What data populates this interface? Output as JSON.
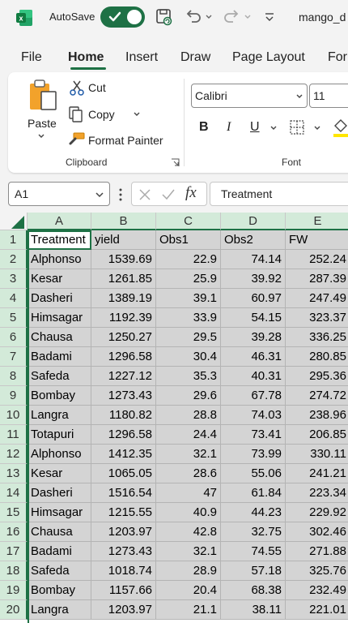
{
  "titlebar": {
    "app_icon": "excel-logo-icon",
    "autosave_label": "AutoSave",
    "autosave_state": "on",
    "filename": "mango_d"
  },
  "menu": [
    "File",
    "Home",
    "Insert",
    "Draw",
    "Page Layout",
    "For"
  ],
  "active_menu": "Home",
  "ribbon": {
    "paste": "Paste",
    "cut": "Cut",
    "copy": "Copy",
    "format_painter": "Format Painter",
    "clipboard_label": "Clipboard",
    "font_name": "Calibri",
    "font_size": "11",
    "bold": "B",
    "italic": "I",
    "underline": "U",
    "font_label": "Font"
  },
  "formula_bar": {
    "name_box": "A1",
    "fx": "fx",
    "formula": "Treatment"
  },
  "columns": [
    "A",
    "B",
    "C",
    "D",
    "E"
  ],
  "headers": [
    "Treatment",
    "yield",
    "Obs1",
    "Obs2",
    "FW"
  ],
  "rows": [
    [
      "Alphonso",
      "1539.69",
      "22.9",
      "74.14",
      "252.24"
    ],
    [
      "Kesar",
      "1261.85",
      "25.9",
      "39.92",
      "287.39"
    ],
    [
      "Dasheri",
      "1389.19",
      "39.1",
      "60.97",
      "247.49"
    ],
    [
      "Himsagar",
      "1192.39",
      "33.9",
      "54.15",
      "323.37"
    ],
    [
      "Chausa",
      "1250.27",
      "29.5",
      "39.28",
      "336.25"
    ],
    [
      "Badami",
      "1296.58",
      "30.4",
      "46.31",
      "280.85"
    ],
    [
      "Safeda",
      "1227.12",
      "35.3",
      "40.31",
      "295.36"
    ],
    [
      "Bombay",
      "1273.43",
      "29.6",
      "67.78",
      "274.72"
    ],
    [
      "Langra",
      "1180.82",
      "28.8",
      "74.03",
      "238.96"
    ],
    [
      "Totapuri",
      "1296.58",
      "24.4",
      "73.41",
      "206.85"
    ],
    [
      "Alphonso",
      "1412.35",
      "32.1",
      "73.99",
      "330.11"
    ],
    [
      "Kesar",
      "1065.05",
      "28.6",
      "55.06",
      "241.21"
    ],
    [
      "Dasheri",
      "1516.54",
      "47",
      "61.84",
      "223.34"
    ],
    [
      "Himsagar",
      "1215.55",
      "40.9",
      "44.23",
      "229.92"
    ],
    [
      "Chausa",
      "1203.97",
      "42.8",
      "32.75",
      "302.46"
    ],
    [
      "Badami",
      "1273.43",
      "32.1",
      "74.55",
      "271.88"
    ],
    [
      "Safeda",
      "1018.74",
      "28.9",
      "57.18",
      "325.76"
    ],
    [
      "Bombay",
      "1157.66",
      "20.4",
      "68.38",
      "232.49"
    ],
    [
      "Langra",
      "1203.97",
      "21.1",
      "38.11",
      "221.01"
    ]
  ],
  "row_numbers": [
    "1",
    "2",
    "3",
    "4",
    "5",
    "6",
    "7",
    "8",
    "9",
    "10",
    "11",
    "12",
    "13",
    "14",
    "15",
    "16",
    "17",
    "18",
    "19",
    "20"
  ],
  "colors": {
    "accent": "#1e7145",
    "selection": "#d4d4d4",
    "header_highlight": "#d3ead9"
  }
}
